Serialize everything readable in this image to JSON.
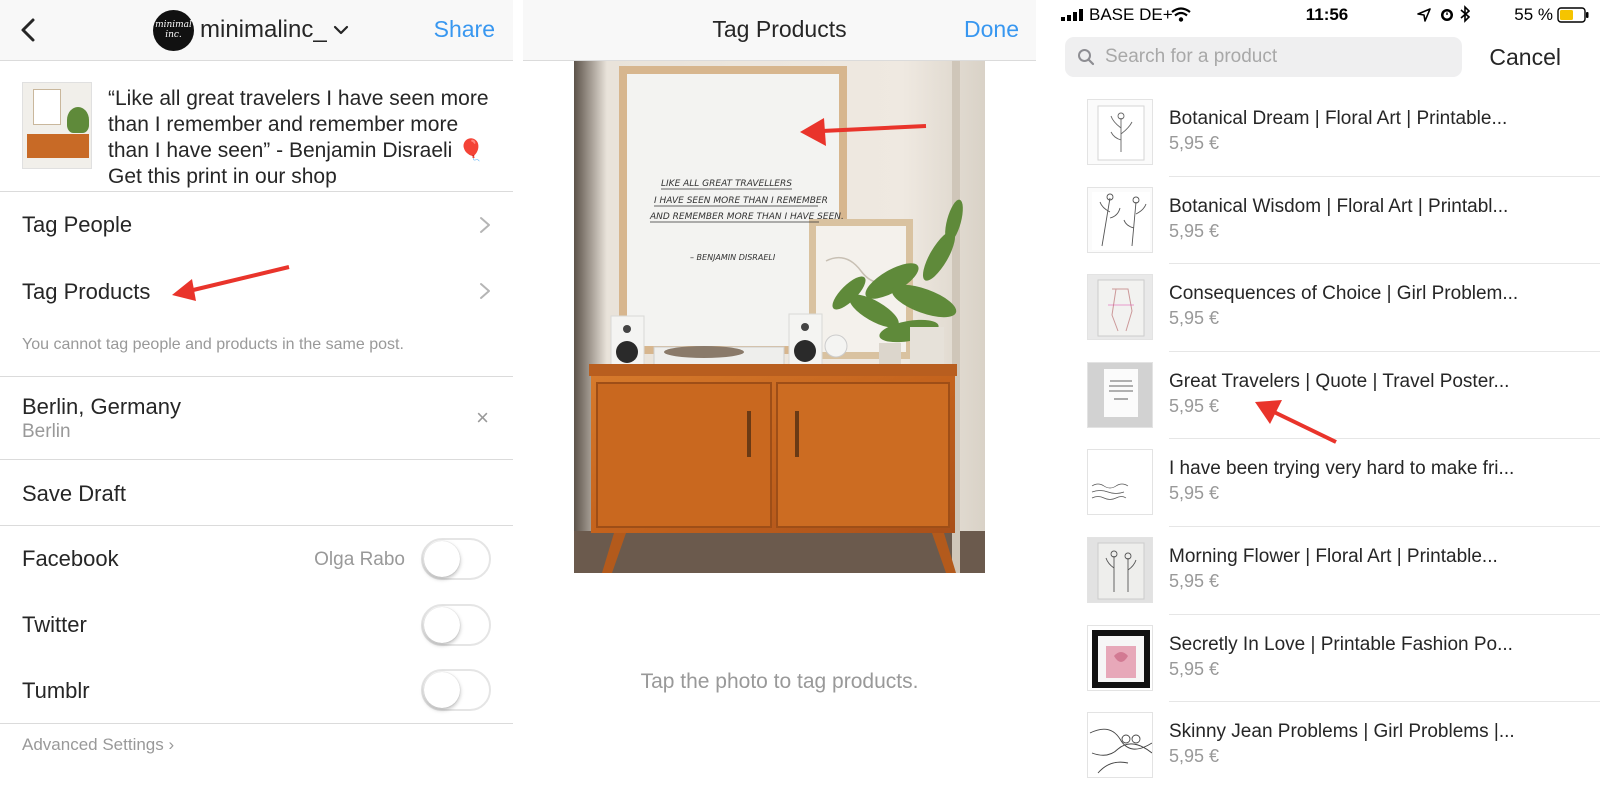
{
  "colors": {
    "accent": "#3897f0",
    "annotation_arrow": "#e9342b",
    "secondary_text": "#999999"
  },
  "edit_screen": {
    "header": {
      "back_icon": "chevron-left-icon",
      "account_avatar_text": "minimal inc.",
      "account_name": "minimalinc_",
      "account_dropdown_icon": "chevron-down-icon",
      "share_label": "Share"
    },
    "caption": "“Like all great travelers I have seen more than I remember and remember more than I have seen” - Benjamin Disraeli 🎈  Get this print in our shop",
    "tag_people_label": "Tag People",
    "tag_products_label": "Tag Products",
    "tag_note": "You cannot tag people and products in the same post.",
    "location": {
      "name": "Berlin, Germany",
      "city": "Berlin",
      "clear_icon": "close-icon"
    },
    "save_draft_label": "Save Draft",
    "share_to": [
      {
        "label": "Facebook",
        "owner": "Olga Rabo",
        "enabled": false
      },
      {
        "label": "Twitter",
        "owner": "",
        "enabled": false
      },
      {
        "label": "Tumblr",
        "owner": "",
        "enabled": false
      }
    ],
    "advanced_label": "Advanced Settings ›"
  },
  "tag_screen": {
    "title": "Tag Products",
    "done_label": "Done",
    "poster_lines": [
      "LIKE ALL GREAT TRAVELLERS",
      "I HAVE SEEN MORE THAN I REMEMBER",
      "AND REMEMBER MORE THAN I HAVE SEEN.",
      "– BENJAMIN DISRAELI"
    ],
    "hint": "Tap the photo to tag products."
  },
  "product_search": {
    "status_bar": {
      "carrier": "BASE DE+",
      "time": "11:56",
      "battery": "55 %"
    },
    "search_placeholder": "Search for a product",
    "search_value": "",
    "cancel_label": "Cancel",
    "products": [
      {
        "name": "Botanical Dream | Floral Art | Printable...",
        "price": "5,95 €"
      },
      {
        "name": "Botanical Wisdom | Floral Art | Printabl...",
        "price": "5,95 €"
      },
      {
        "name": "Consequences of Choice | Girl Problem...",
        "price": "5,95 €"
      },
      {
        "name": "Great Travelers | Quote | Travel Poster...",
        "price": "5,95 €"
      },
      {
        "name": "I have been trying very hard to make fri...",
        "price": "5,95 €"
      },
      {
        "name": "Morning Flower | Floral Art | Printable...",
        "price": "5,95 €"
      },
      {
        "name": "Secretly In Love | Printable Fashion Po...",
        "price": "5,95 €"
      },
      {
        "name": "Skinny Jean Problems | Girl Problems |...",
        "price": "5,95 €"
      }
    ]
  }
}
